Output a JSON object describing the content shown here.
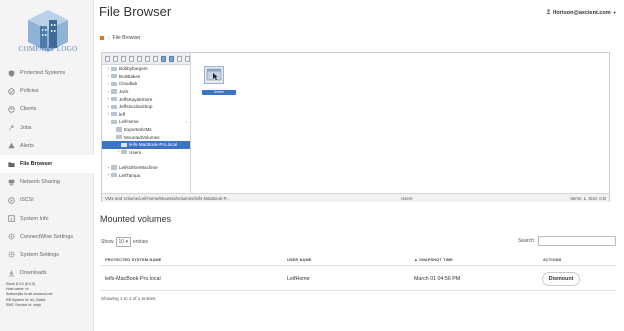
{
  "sidebar": {
    "logo_text": "COMPANY LOGO",
    "items": [
      {
        "label": "Protected Systems",
        "icon": "shield-icon"
      },
      {
        "label": "Policies",
        "icon": "policy-icon"
      },
      {
        "label": "Clients",
        "icon": "clients-icon"
      },
      {
        "label": "Jobs",
        "icon": "wrench-icon"
      },
      {
        "label": "Alerts",
        "icon": "alert-icon"
      },
      {
        "label": "File Browser",
        "icon": "folder-icon"
      },
      {
        "label": "Network Sharing",
        "icon": "network-icon"
      },
      {
        "label": "iSCSI",
        "icon": "iscsi-icon"
      },
      {
        "label": "System Info",
        "icon": "info-icon"
      },
      {
        "label": "ConnectWise Settings",
        "icon": "gear-icon"
      },
      {
        "label": "System Settings",
        "icon": "gear-icon"
      },
      {
        "label": "Downloads",
        "icon": "download-icon"
      }
    ],
    "active_index": 5,
    "version_lines": [
      "Slack 6.0.0 (6.0.0)",
      "Host name: rb",
      "lfortson@s.rb.atl.siocloud.net",
      "RB System Id: lal_33a64",
      "RMC Service id: cdqh"
    ]
  },
  "header": {
    "title": "File Browser",
    "user": "lfortson@axcient.com",
    "breadcrumb": "File Browser"
  },
  "colors": {
    "accent": "#3a74c4",
    "breadcrumb_home": "#e0781e",
    "sidebar_bg": "#f4f4f6",
    "logo": "#5a7fa5"
  },
  "file_browser": {
    "tree": [
      {
        "label": "Bobbyburgers",
        "depth": 0,
        "toggle": "+"
      },
      {
        "label": "BurtBakes",
        "depth": 0,
        "toggle": "+"
      },
      {
        "label": "Cloudlab",
        "depth": 0,
        "toggle": "+"
      },
      {
        "label": "Jack",
        "depth": 0,
        "toggle": "+"
      },
      {
        "label": "JeffsKayakStore",
        "depth": 0,
        "toggle": "+"
      },
      {
        "label": "JeffsScubaShop",
        "depth": 0,
        "toggle": "+"
      },
      {
        "label": "leff",
        "depth": 0,
        "toggle": "+"
      },
      {
        "label": "LeifHome",
        "depth": 0,
        "toggle": "-",
        "chevron": "›"
      },
      {
        "label": "ExportedVMs",
        "depth": 1,
        "toggle": ""
      },
      {
        "label": "MountedVolumes",
        "depth": 1,
        "toggle": "-"
      },
      {
        "label": "leifs-MacBook-Pro.local",
        "depth": 2,
        "toggle": "+",
        "selected": true
      },
      {
        "label": "Users",
        "depth": 2,
        "toggle": "+"
      },
      {
        "label": "",
        "depth": 1,
        "toggle": ""
      },
      {
        "label": "LeifsOtherMachine",
        "depth": 0,
        "toggle": "+"
      },
      {
        "label": "LeifTampa",
        "depth": 0,
        "toggle": "+"
      }
    ],
    "file_label": "\\Users",
    "status_path": "VMs and Volume/LeifHome/MountedVolumes/leifs-MacBook-P...",
    "status_owner": "Users",
    "status_items": "Items: 1, Size: 0 B"
  },
  "mounted": {
    "title": "Mounted volumes",
    "show_label": "Show",
    "entries_value": "10",
    "entries_label": "entries",
    "search_label": "Search:",
    "columns": [
      "PROTECTED SYSTEM NAME",
      "USER NAME",
      "SNAPSHOT TIME",
      "ACTIONS"
    ],
    "rows": [
      {
        "system": "leifs-MacBook-Pro.local",
        "user": "LeifHome",
        "time": "March 01 04:56 PM",
        "action": "Dismount"
      }
    ],
    "showing_text": "Showing 1 to 1 of 1 entries"
  }
}
